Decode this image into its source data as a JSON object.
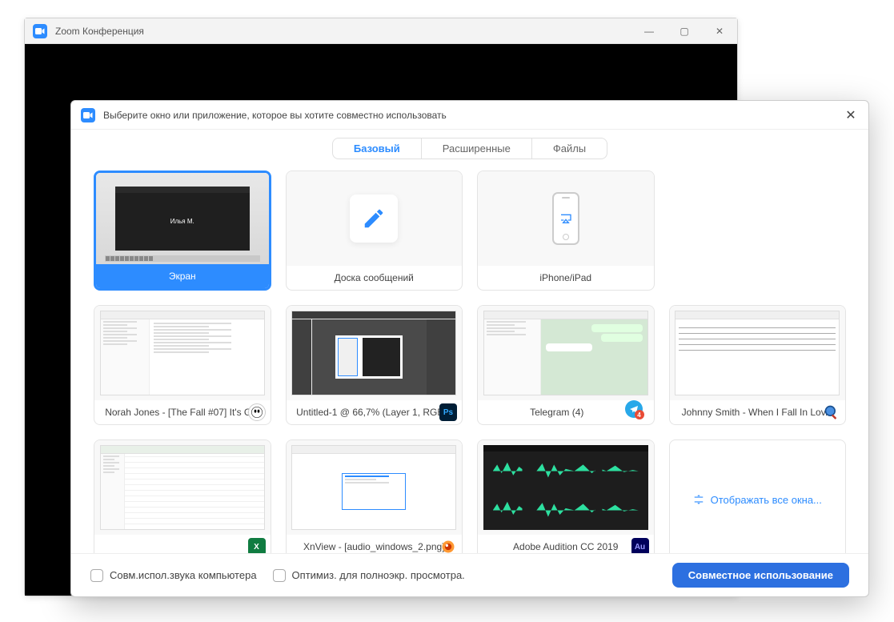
{
  "bgWindow": {
    "title": "Zoom Конференция"
  },
  "dialog": {
    "title": "Выберите окно или приложение, которое вы хотите совместно использовать",
    "tabs": [
      "Базовый",
      "Расширенные",
      "Файлы"
    ],
    "activeTab": 0,
    "tiles": [
      {
        "label": "Экран",
        "selected": true,
        "thumbUser": "Илья М."
      },
      {
        "label": "Доска сообщений"
      },
      {
        "label": "iPhone/iPad"
      },
      {
        "label": "Norah Jones - [The Fall #07] It's G...",
        "appIcon": "foobar"
      },
      {
        "label": "Untitled-1 @ 66,7% (Layer 1, RGB...",
        "appIcon": "ps",
        "appIconText": "Ps"
      },
      {
        "label": "Telegram (4)",
        "appIcon": "tg"
      },
      {
        "label": "Johnny Smith - When I Fall In Lov...",
        "appIcon": "mag"
      },
      {
        "label": "",
        "appIcon": "xl",
        "appIconText": "X"
      },
      {
        "label": "XnView - [audio_windows_2.png]",
        "appIcon": "xn"
      },
      {
        "label": "Adobe Audition CC 2019",
        "appIcon": "au",
        "appIconText": "Au"
      }
    ],
    "moreLabel": "Отображать все окна...",
    "footer": {
      "checkAudio": "Совм.испол.звука компьютера",
      "checkFullscreen": "Оптимиз. для полноэкр. просмотра.",
      "shareButton": "Совместное использование"
    }
  }
}
